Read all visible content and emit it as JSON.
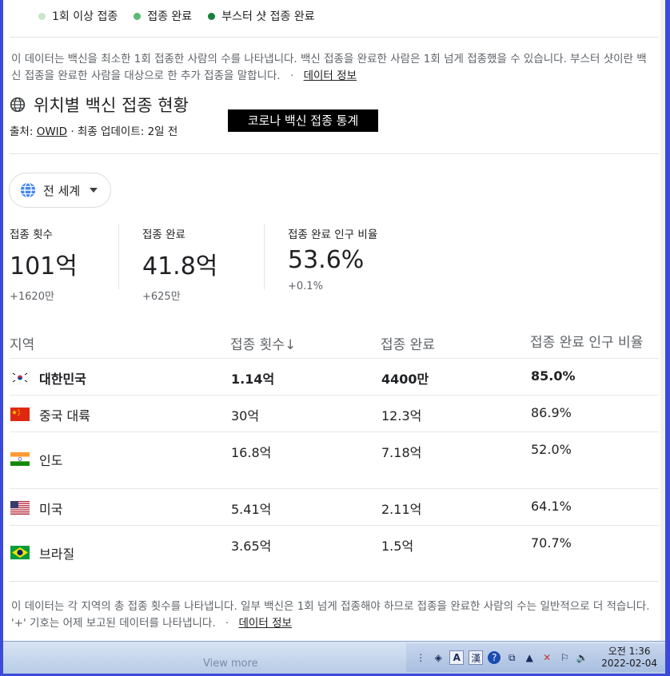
{
  "legend": [
    {
      "label": "1회 이상 접종",
      "color": "#c8e6c9"
    },
    {
      "label": "접종 완료",
      "color": "#5bb974"
    },
    {
      "label": "부스터 샷 접종 완료",
      "color": "#188038"
    }
  ],
  "top_desc": {
    "text": "이 데이터는 백신을 최소한 1회 접종한 사람의 수를 나타냅니다. 백신 접종을 완료한 사람은 1회 넘게 접종했을 수 있습니다. 부스터 샷이란 백신 접종을 완료한 사람을 대상으로 한 추가 접종을 말합니다.",
    "separator": "·",
    "link": "데이터 정보"
  },
  "title": "위치별 백신 접종 현황",
  "source": {
    "prefix": "출처:",
    "link": "OWID",
    "suffix": "· 최종 업데이트: 2일 전"
  },
  "overlay_label": "코로나 백신 접종 통계",
  "region_selector": "전 세계",
  "stats": [
    {
      "label": "접종 횟수",
      "value": "101억",
      "delta": "+1620만"
    },
    {
      "label": "접종 완료",
      "value": "41.8억",
      "delta": "+625만"
    },
    {
      "label": "접종 완료 인구 비율",
      "value": "53.6%",
      "delta": "+0.1%"
    }
  ],
  "table": {
    "headers": [
      "지역",
      "접종 횟수↓",
      "접종 완료",
      "접종 완료 인구 비율"
    ],
    "rows": [
      {
        "region": "대한민국",
        "doses": "1.14억",
        "complete": "4400만",
        "pct": "85.0%"
      },
      {
        "region": "중국 대륙",
        "doses": "30억",
        "complete": "12.3억",
        "pct": "86.9%"
      },
      {
        "region": "인도",
        "doses": "16.8억",
        "complete": "7.18억",
        "pct": "52.0%"
      },
      {
        "region": "미국",
        "doses": "5.41억",
        "complete": "2.11억",
        "pct": "64.1%"
      },
      {
        "region": "브라질",
        "doses": "3.65억",
        "complete": "1.5억",
        "pct": "70.7%"
      }
    ]
  },
  "bottom_desc": {
    "text": "이 데이터는 각 지역의 총 접종 횟수를 나타냅니다. 일부 백신은 1회 넘게 접종해야 하므로 접종을 완료한 사람의 수는 일반적으로 더 적습니다. '+' 기호는 어제 보고된 데이터를 나타냅니다.",
    "separator": "·",
    "link": "데이터 정보"
  },
  "taskbar": {
    "ghost_text": "View more",
    "ime_labels": [
      "A",
      "漢"
    ],
    "time": "오전 1:36",
    "date": "2022-02-04"
  }
}
